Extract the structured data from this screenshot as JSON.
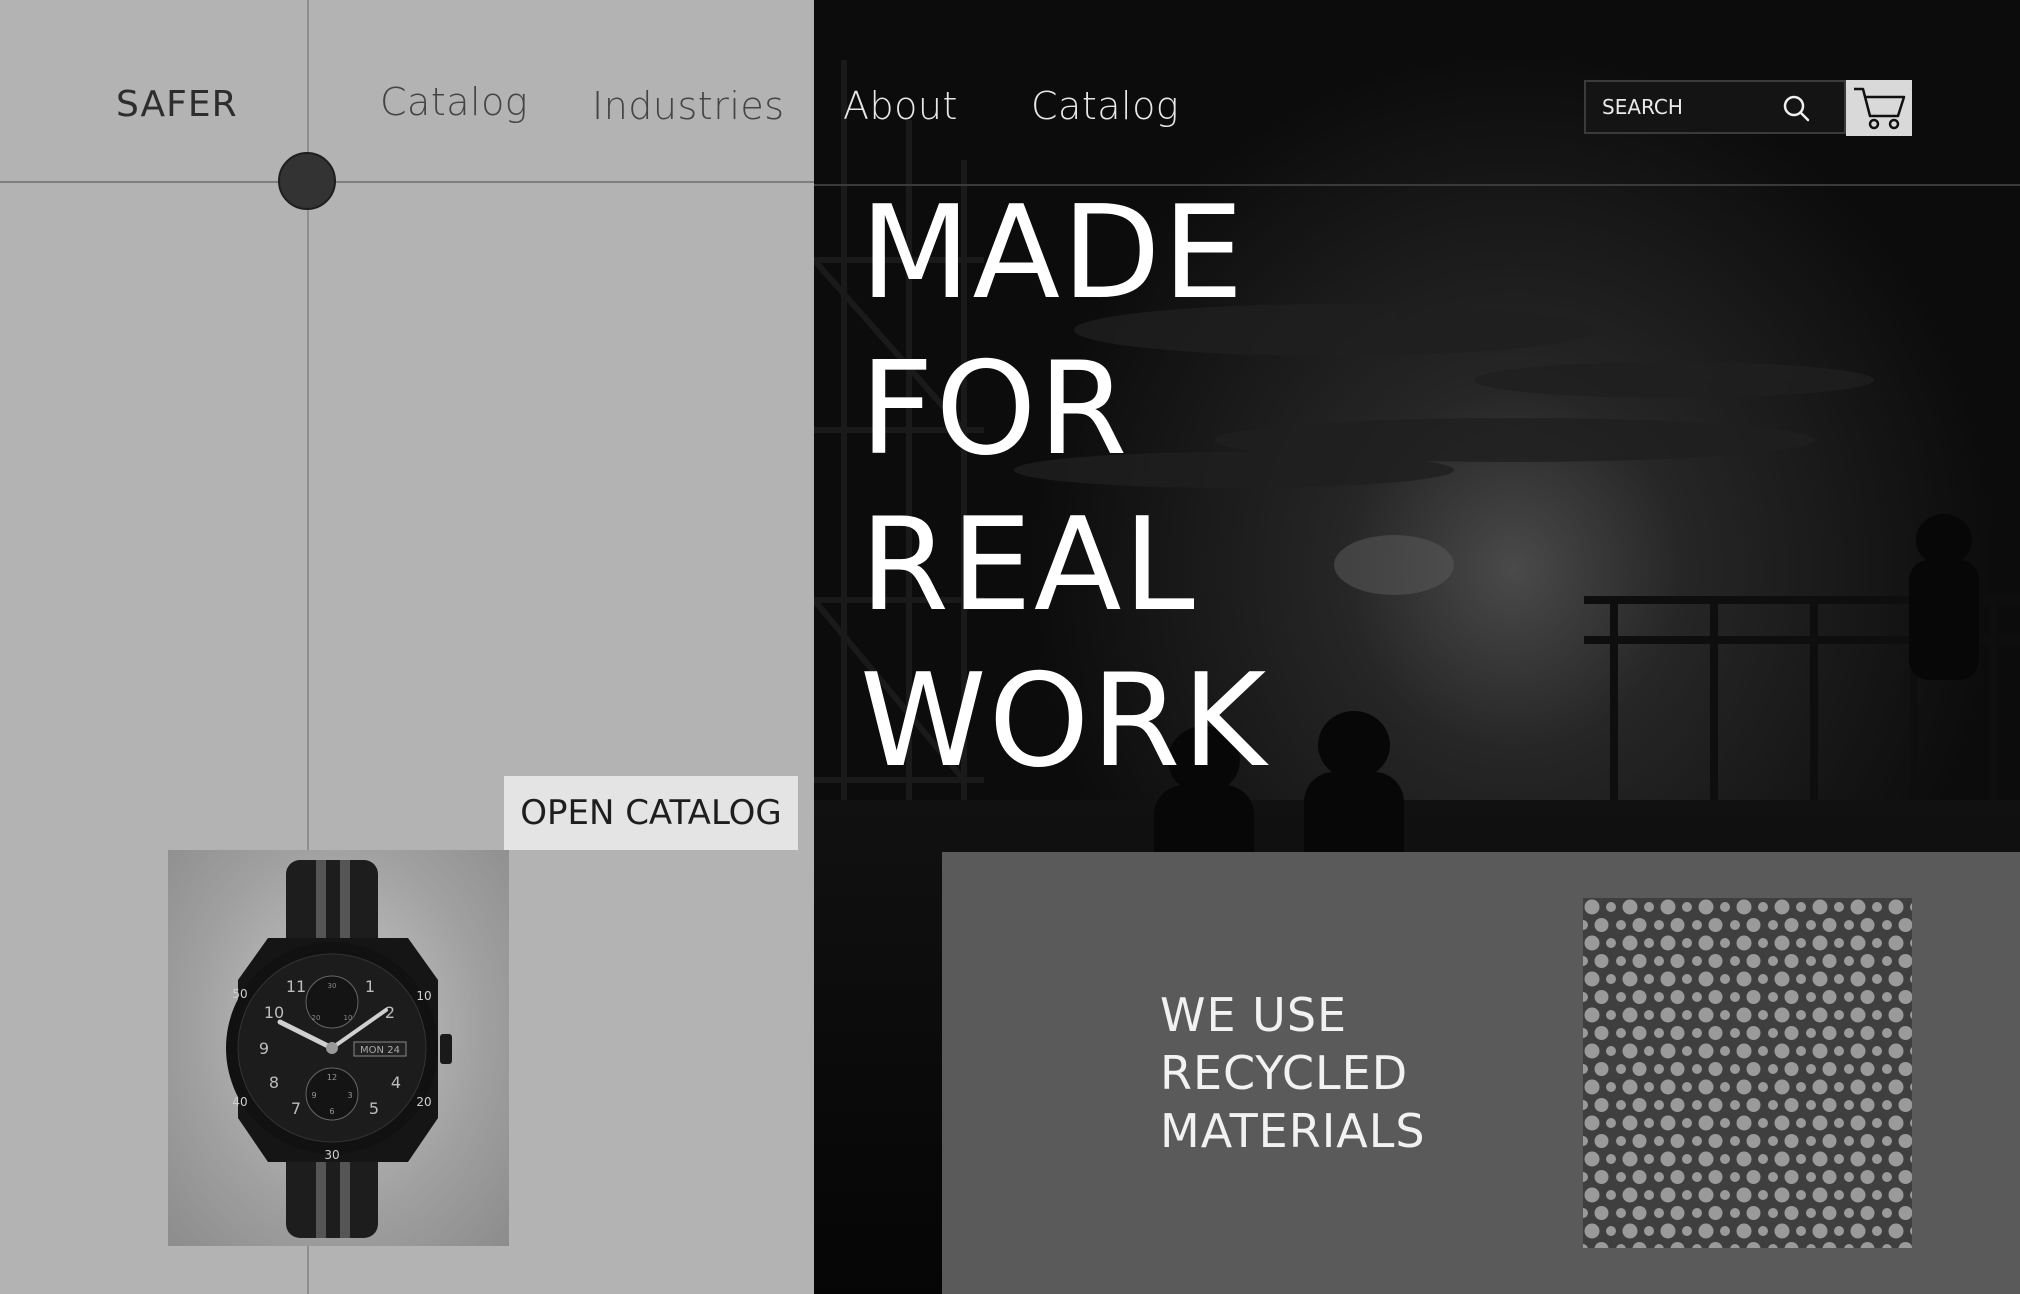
{
  "brand": {
    "logo": "SAFER"
  },
  "nav": {
    "items": [
      "Catalog",
      "Industries",
      "About",
      "Catalog"
    ]
  },
  "search": {
    "placeholder": "SEARCH"
  },
  "hero": {
    "headline": [
      "MADE",
      "FOR",
      "REAL",
      "WORK"
    ]
  },
  "cta": {
    "open_catalog": "OPEN CATALOG"
  },
  "product": {
    "watch": {
      "date_window": "MON 24",
      "bezel_numbers": [
        "10",
        "20",
        "30",
        "40",
        "50"
      ],
      "dial_numbers": [
        "1",
        "2",
        "4",
        "5",
        "7",
        "8",
        "9",
        "10",
        "11"
      ],
      "subdial_top": [
        "30",
        "10",
        "20"
      ],
      "subdial_bottom": [
        "12",
        "3",
        "6",
        "9"
      ]
    }
  },
  "recycled": {
    "lines": [
      "WE USE",
      "RECYCLED",
      "MATERIALS"
    ]
  },
  "icons": {
    "search": "search-icon",
    "cart": "cart-icon"
  }
}
